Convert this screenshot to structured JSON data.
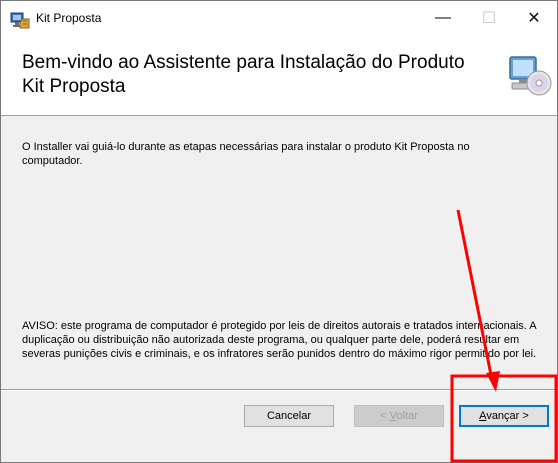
{
  "window": {
    "title": "Kit Proposta",
    "minimize_glyph": "—",
    "maximize_glyph": "☐",
    "close_glyph": "✕"
  },
  "header": {
    "title": "Bem-vindo ao Assistente para Instalação do Produto Kit Proposta",
    "icon": "computer-cd-icon"
  },
  "content": {
    "intro": "O Installer vai guiá-lo durante as etapas necessárias para instalar o produto Kit Proposta no computador.",
    "warning": "AVISO: este programa de computador é protegido por leis de direitos autorais e tratados internacionais. A duplicação ou distribuição não autorizada deste programa, ou qualquer parte dele, poderá resultar em severas punições civis e criminais, e os infratores serão punidos dentro do máximo rigor permitido por lei."
  },
  "buttons": {
    "cancel": "Cancelar",
    "back_prefix": "< ",
    "back_hotkey": "V",
    "back_rest": "oltar",
    "next_hotkey": "A",
    "next_rest": "vançar >"
  },
  "annotations": {
    "arrow_color": "#ff0000",
    "highlight_color": "#ff0000"
  }
}
